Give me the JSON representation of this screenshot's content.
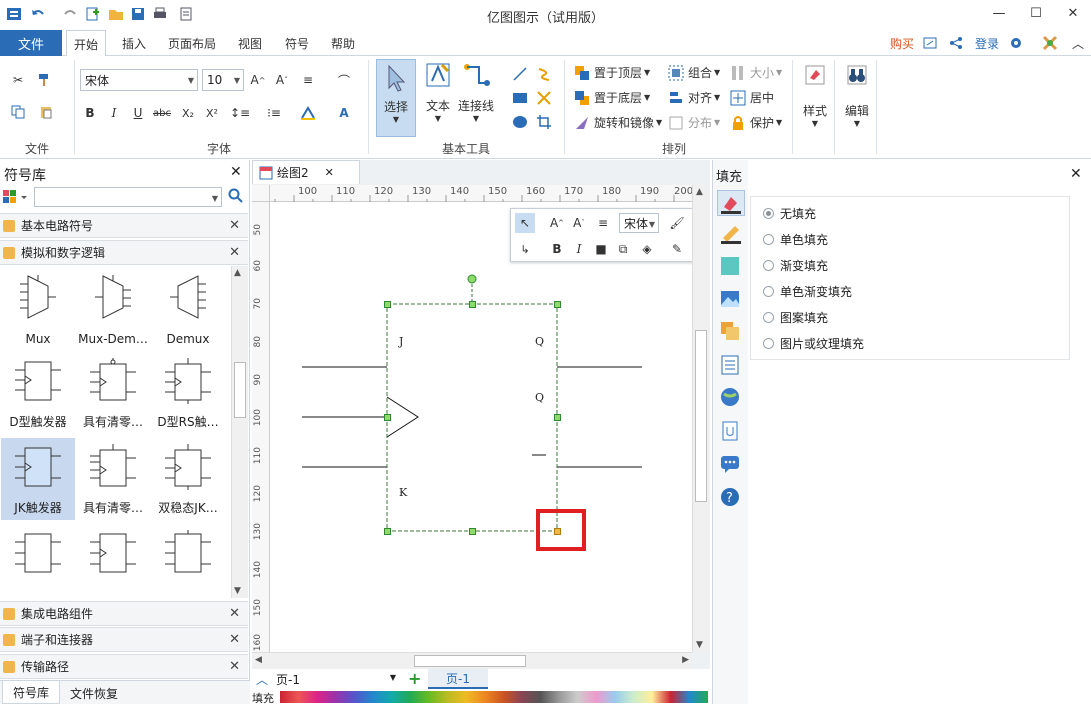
{
  "titlebar": {
    "title": "亿图图示（试用版）"
  },
  "menubar": {
    "file": "文件",
    "tabs": [
      "开始",
      "插入",
      "页面布局",
      "视图",
      "符号",
      "帮助"
    ],
    "buy": "购买",
    "login": "登录"
  },
  "ribbon": {
    "font_name": "宋体",
    "font_size": "10",
    "groups": {
      "file": "文件",
      "font": "字体",
      "tools": "基本工具",
      "arrange": "排列"
    },
    "select": "选择",
    "text": "文本",
    "connector": "连接线",
    "bring_front": "置于顶层",
    "send_back": "置于底层",
    "rotate": "旋转和镜像",
    "group": "组合",
    "align": "对齐",
    "distribute": "分布",
    "size": "大小",
    "center": "居中",
    "protect": "保护",
    "style": "样式",
    "edit": "编辑"
  },
  "left_panel": {
    "title": "符号库",
    "categories_top": [
      "基本电路符号",
      "模拟和数字逻辑"
    ],
    "symbols": [
      "Mux",
      "Mux-Dem…",
      "Demux",
      "D型触发器",
      "具有清零…",
      "D型RS触…",
      "JK触发器",
      "具有清零…",
      "双稳态JK…",
      "",
      "",
      ""
    ],
    "categories_bottom": [
      "集成电路组件",
      "端子和连接器",
      "传输路径"
    ],
    "bottom_tabs": [
      "符号库",
      "文件恢复"
    ]
  },
  "canvas": {
    "doc_tab": "绘图2",
    "ruler_top": [
      "100",
      "110",
      "120",
      "130",
      "140",
      "150",
      "160",
      "170",
      "180",
      "190",
      "200"
    ],
    "ruler_left": [
      "50",
      "60",
      "70",
      "80",
      "90",
      "100",
      "110",
      "120",
      "130",
      "140",
      "150",
      "160"
    ],
    "shape_labels": {
      "j": "J",
      "k": "K",
      "q1": "Q",
      "q2": "Q"
    },
    "float_font": "宋体"
  },
  "pagebar": {
    "page_select": "页-1",
    "page_tab": "页-1",
    "fill_label": "填充"
  },
  "right_panel": {
    "title": "填充",
    "options": [
      "无填充",
      "单色填充",
      "渐变填充",
      "单色渐变填充",
      "图案填充",
      "图片或纹理填充"
    ],
    "selected": "无填充"
  },
  "colors": {
    "accent": "#2a6cb6",
    "highlight": "#e02020",
    "buy": "#d9531e"
  }
}
